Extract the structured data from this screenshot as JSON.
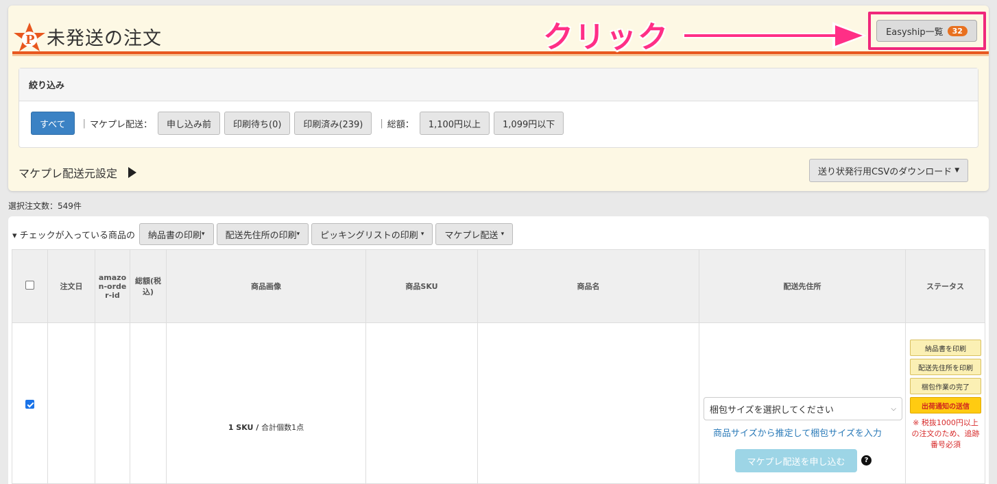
{
  "header": {
    "title": "未発送の注文",
    "callout": "クリック",
    "easyship_label": "Easyship一覧",
    "easyship_count": "32"
  },
  "filter": {
    "heading": "絞り込み",
    "all_label": "すべて",
    "makepre_label": "マケプレ配送：",
    "makepre_options": [
      "申し込み前",
      "印刷待ち(0)",
      "印刷済み(239)"
    ],
    "total_label": "総額：",
    "total_options": [
      "1,100円以上",
      "1,099円以下"
    ]
  },
  "settings": {
    "makepre_origin": "マケプレ配送元設定",
    "csv_download": "送り状発行用CSVのダウンロード"
  },
  "summary": {
    "selected_count": "選択注文数：549件"
  },
  "actions": {
    "label": "チェックが入っている商品の",
    "buttons": [
      "納品書の印刷",
      "配送先住所の印刷",
      "ピッキングリストの印刷",
      "マケプレ配送"
    ]
  },
  "table": {
    "headers": {
      "order_date": "注文日",
      "amazon_order_id": "amazon-order-id",
      "total": "総額(税込)",
      "image": "商品画像",
      "sku": "商品SKU",
      "name": "商品名",
      "address": "配送先住所",
      "status": "ステータス"
    },
    "row": {
      "sku_summary": "1 SKU /",
      "sku_summary_light": "合計個数1点",
      "package_placeholder": "梱包サイズを選択してください",
      "estimate_link": "商品サイズから推定して梱包サイズを入力",
      "apply_button": "マケプレ配送を申し込む",
      "help": "?",
      "status_buttons": [
        "納品書を印刷",
        "配送先住所を印刷",
        "梱包作業の完了"
      ],
      "ship_notice": "出荷通知の送信",
      "note": "※ 税抜1000円以上の注文のため、追跡番号必須"
    }
  },
  "colors": {
    "accent": "#e8571f",
    "callout": "#ff2f86",
    "primary": "#3b82c4"
  }
}
